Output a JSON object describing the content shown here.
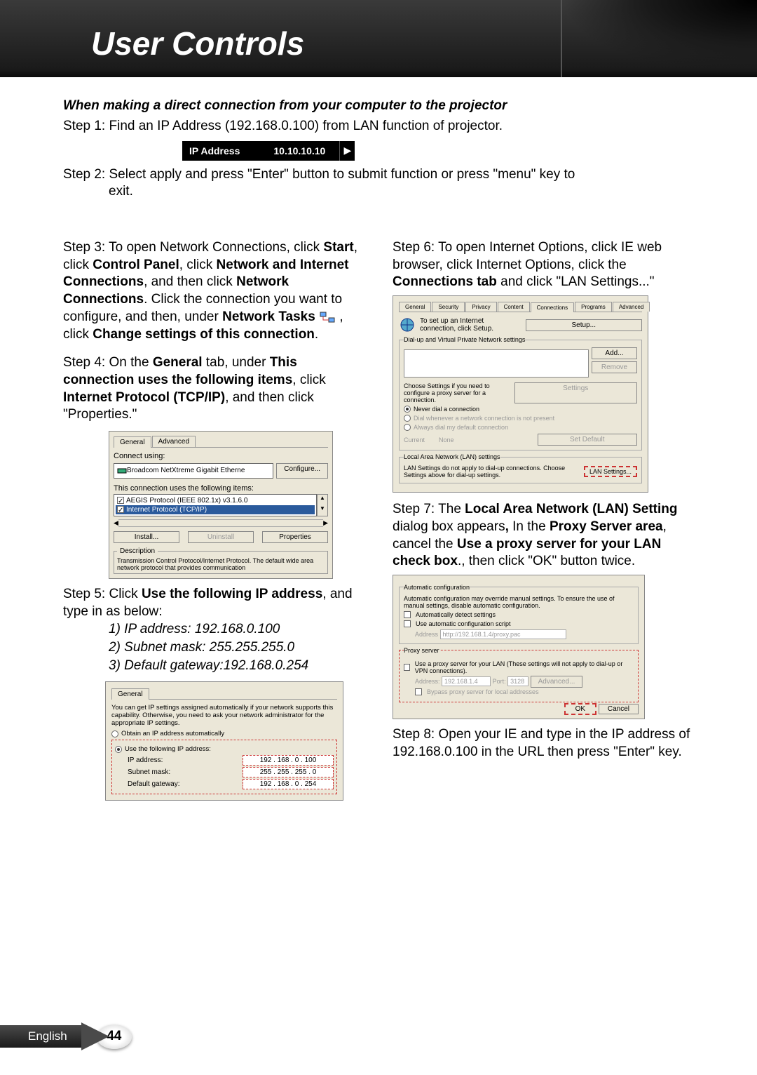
{
  "page": {
    "title": "User Controls",
    "language": "English",
    "number": "44"
  },
  "intro": {
    "heading": "When making a direct connection from your computer to the projector",
    "step1": "Step 1: Find an IP Address (192.168.0.100) from LAN function of projector.",
    "step2_a": "Step 2: Select apply and press \"Enter\" button to submit function or press \"menu\" key to",
    "step2_b": "exit."
  },
  "ip_bar": {
    "label": "IP Address",
    "value": "10.10.10.10"
  },
  "step3": {
    "prefix": "Step 3: To open Network Connections, click ",
    "b1": "Start",
    "t1": ", click ",
    "b2": "Control Panel",
    "t2": ", click ",
    "b3": "Network and Internet Connections",
    "t3": ", and then click ",
    "b4": "Network Connections",
    "t4": ". Click the connection you want to configure, and then, under ",
    "b5": "Network Tasks",
    "t5": ", click ",
    "b6": "Change settings of this connection",
    "t6": "."
  },
  "step4": {
    "prefix": "Step 4: On the ",
    "b1": "General",
    "t1": " tab, under ",
    "b2": "This connection uses the following items",
    "t2": ", click ",
    "b3": "Internet Protocol (TCP/IP)",
    "t3": ", and then click \"Properties.\""
  },
  "conn_dialog": {
    "tab1": "General",
    "tab2": "Advanced",
    "connect_using": "Connect using:",
    "adapter": "Broadcom NetXtreme Gigabit Etherne",
    "configure": "Configure...",
    "items_label": "This connection uses the following items:",
    "item1": "AEGIS Protocol (IEEE 802.1x) v3.1.6.0",
    "item2": "Internet Protocol (TCP/IP)",
    "install": "Install...",
    "uninstall": "Uninstall",
    "properties": "Properties",
    "desc_label": "Description",
    "desc_text": "Transmission Control Protocol/Internet Protocol. The default wide area network protocol that provides communication"
  },
  "step5": {
    "line1a": "Step 5: Click ",
    "line1b": "Use the following IP address",
    "line1c": ", and type in as below:",
    "sub1": "1) IP address: 192.168.0.100",
    "sub2": "2) Subnet mask: 255.255.255.0",
    "sub3": "3) Default gateway:192.168.0.254"
  },
  "ip_dialog": {
    "tab": "General",
    "note": "You can get IP settings assigned automatically if your network supports this capability. Otherwise, you need to ask your network administrator for the appropriate IP settings.",
    "radio1": "Obtain an IP address automatically",
    "radio2": "Use the following IP address:",
    "ip_label": "IP address:",
    "ip_val": "192 . 168 .  0  . 100",
    "mask_label": "Subnet mask:",
    "mask_val": "255 . 255 . 255 .  0",
    "gw_label": "Default gateway:",
    "gw_val": "192 . 168 .  0  . 254"
  },
  "step6": {
    "prefix": "Step 6: To open Internet Options, click IE web browser, click Internet Options, click the ",
    "b1": "Connections tab",
    "t1": " and click \"LAN Settings...\""
  },
  "io_dialog": {
    "tabs": [
      "General",
      "Security",
      "Privacy",
      "Content",
      "Connections",
      "Programs",
      "Advanced"
    ],
    "setup_text": "To set up an Internet connection, click Setup.",
    "setup_btn": "Setup...",
    "dialup_label": "Dial-up and Virtual Private Network settings",
    "add_btn": "Add...",
    "remove_btn": "Remove",
    "settings_btn": "Settings",
    "choose_text": "Choose Settings if you need to configure a proxy server for a connection.",
    "r1": "Never dial a connection",
    "r2": "Dial whenever a network connection is not present",
    "r3": "Always dial my default connection",
    "current": "Current",
    "none": "None",
    "setdef": "Set Default",
    "lan_fieldset": "Local Area Network (LAN) settings",
    "lan_text": "LAN Settings do not apply to dial-up connections. Choose Settings above for dial-up settings.",
    "lan_btn": "LAN Settings..."
  },
  "step7": {
    "prefix": "Step 7: The ",
    "b1": "Local Area Network (LAN) Setting",
    "t1": " dialog box appears",
    "b2": ",",
    "t2": " In the ",
    "b3": "Proxy Server area",
    "t3": ", cancel the ",
    "b4": "Use a proxy server for your LAN check box",
    "t4": "., then click \"OK\" button twice."
  },
  "lan_dialog": {
    "auto_label": "Automatic configuration",
    "auto_text": "Automatic configuration may override manual settings. To ensure the use of manual settings, disable automatic configuration.",
    "cb1": "Automatically detect settings",
    "cb2": "Use automatic configuration script",
    "addr_label": "Address",
    "addr_val": "http://192.168.1.4/proxy.pac",
    "proxy_label": "Proxy server",
    "proxy_cb": "Use a proxy server for your LAN (These settings will not apply to dial-up or VPN connections).",
    "paddr_label": "Address:",
    "paddr_val": "192.168.1.4",
    "port_label": "Port:",
    "port_val": "3128",
    "adv_btn": "Advanced...",
    "bypass": "Bypass proxy server for local addresses",
    "ok": "OK",
    "cancel": "Cancel"
  },
  "step8": "Step 8: Open your IE and type in the IP address of 192.168.0.100 in the URL then press \"Enter\" key."
}
